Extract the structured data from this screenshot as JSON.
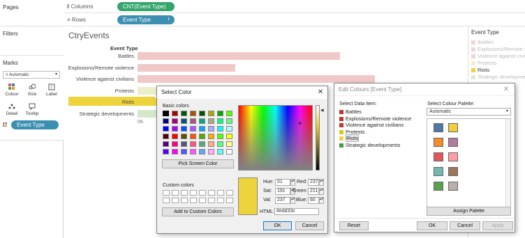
{
  "left": {
    "pages_label": "Pages",
    "filters_label": "Filters",
    "marks_label": "Marks",
    "mark_type": "Automatic",
    "cards": [
      {
        "label": "Colour",
        "icon": "colour-icon"
      },
      {
        "label": "Size",
        "icon": "size-icon"
      },
      {
        "label": "Label",
        "icon": "label-icon"
      },
      {
        "label": "Detail",
        "icon": "detail-icon"
      },
      {
        "label": "Tooltip",
        "icon": "tooltip-icon"
      }
    ],
    "color_pill": "Event Type"
  },
  "shelves": {
    "columns_label": "Columns",
    "columns_pill": "CNT(Event Type)",
    "rows_label": "Rows",
    "rows_pill": "Event Type"
  },
  "viz": {
    "title": "CtryEvents",
    "header": "Event Type",
    "axis_zero": "0K"
  },
  "chart_data": {
    "type": "bar",
    "categories": [
      "Battles",
      "Explosions/Remote violence",
      "Violence against civilians",
      "Protests",
      "Riots",
      "Strategic developments"
    ],
    "values": [
      290,
      140,
      340,
      120,
      100,
      95
    ],
    "colors": [
      "#f0c8c8",
      "#f0c8c8",
      "#f0c8c8",
      "#ebeec8",
      "#edd33c",
      "#d6e8cc"
    ],
    "highlighted": "Riots",
    "xlim": [
      0,
      380
    ]
  },
  "legend": {
    "title": "Event Type",
    "items": [
      {
        "label": "Battles",
        "color": "#f2d4d4"
      },
      {
        "label": "Explosions/Remote violence",
        "color": "#f2d4d4"
      },
      {
        "label": "Violence against civilians",
        "color": "#f2d4d4"
      },
      {
        "label": "Protests",
        "color": "#f0f0c8"
      },
      {
        "label": "Riots",
        "color": "#edd33c"
      },
      {
        "label": "Strategic developments",
        "color": "#d8ecd0"
      }
    ]
  },
  "select_color": {
    "title": "Select Color",
    "basic_label": "Basic colors",
    "pick_button": "Pick Screen Color",
    "custom_label": "Custom colors",
    "add_button": "Add to Custom Colors",
    "fields": {
      "hue_label": "Hue:",
      "hue": "51",
      "sat_label": "Sat:",
      "sat": "191",
      "val_label": "Val:",
      "val": "237",
      "red_label": "Red:",
      "red": "237",
      "green_label": "Green:",
      "green": "211",
      "blue_label": "Blue:",
      "blue": "60",
      "html_label": "HTML:",
      "html": "#edd33c"
    },
    "ok": "OK",
    "cancel": "Cancel",
    "current_color": "#edd33c",
    "basic_colors": [
      "#000000",
      "#aa0000",
      "#005500",
      "#aa5500",
      "#005500",
      "#aaaa00",
      "#00aa00",
      "#55ff00",
      "#000080",
      "#aa007f",
      "#00557f",
      "#aa557f",
      "#00aa7f",
      "#aaaa7f",
      "#00ff7f",
      "#55ff7f",
      "#0000ff",
      "#aa00ff",
      "#0055ff",
      "#aa55ff",
      "#00aaff",
      "#aaaaff",
      "#00ffff",
      "#aaffff",
      "#550000",
      "#ff0000",
      "#555500",
      "#ff5500",
      "#55aa00",
      "#ffaa00",
      "#55ff00",
      "#ffff00",
      "#55007f",
      "#ff007f",
      "#55557f",
      "#ff557f",
      "#55aa7f",
      "#ffaa7f",
      "#55ff7f",
      "#ffff7f",
      "#5500ff",
      "#ff00ff",
      "#5555ff",
      "#ff55ff",
      "#55aaff",
      "#ffaaff",
      "#55ffff",
      "#ffffff"
    ]
  },
  "edit_colours": {
    "title": "Edit Colours [Event Type]",
    "data_item_label": "Select Data Item:",
    "palette_label": "Select Colour Palette:",
    "palette_value": "Automatic",
    "items": [
      {
        "label": "Battles",
        "color": "#c0392b"
      },
      {
        "label": "Explosions/Remote violence",
        "color": "#c0392b"
      },
      {
        "label": "Violence against civilians",
        "color": "#c0392b"
      },
      {
        "label": "Protests",
        "color": "#d8c81e"
      },
      {
        "label": "Riots",
        "color": "#edd33c"
      },
      {
        "label": "Strategic developments",
        "color": "#4a9a44"
      }
    ],
    "palette_colors": [
      "#4e79a7",
      "#f1ce3f",
      "#f28e2b",
      "#b07aa1",
      "#e15759",
      "#ff9da7",
      "#76b7b2",
      "#9c755f",
      "#59a14f",
      "#bab0ac"
    ],
    "assign_button": "Assign Palette",
    "reset_button": "Reset",
    "ok": "OK",
    "cancel": "Cancel",
    "apply": "Apply"
  }
}
